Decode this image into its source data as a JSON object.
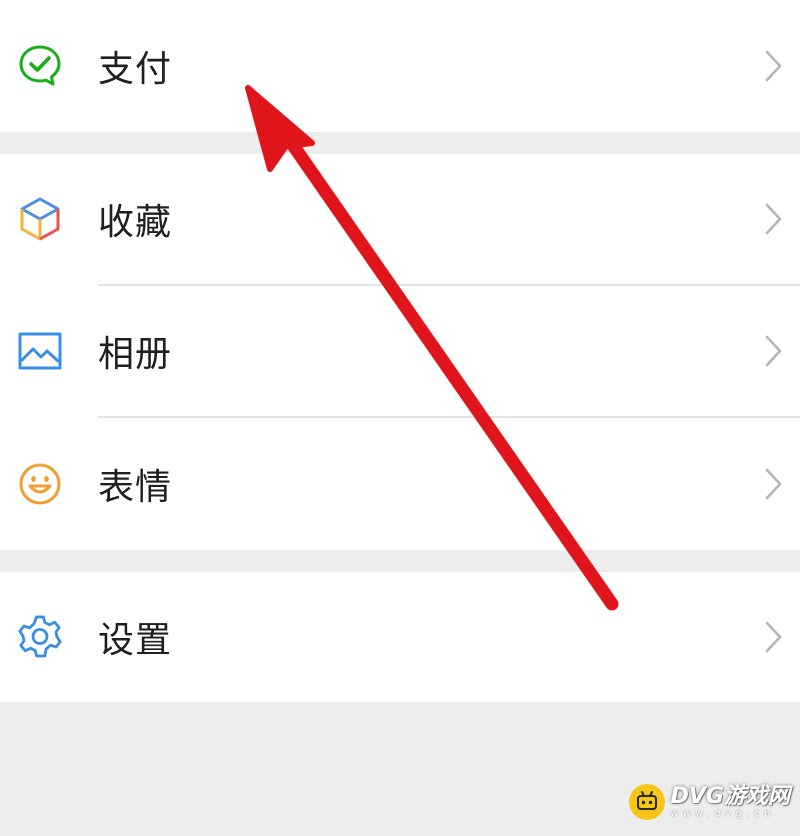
{
  "menu": {
    "items": [
      {
        "label": "支付",
        "icon": "wallet-check-icon",
        "color": "#1aad19"
      },
      {
        "label": "收藏",
        "icon": "cube-icon",
        "color": "#4a90e2"
      },
      {
        "label": "相册",
        "icon": "photo-album-icon",
        "color": "#3a8ee6"
      },
      {
        "label": "表情",
        "icon": "smiley-icon",
        "color": "#f0a030"
      },
      {
        "label": "设置",
        "icon": "gear-icon",
        "color": "#3a8ee6"
      }
    ]
  },
  "annotation": {
    "arrow_color": "#e0151b",
    "arrow_target": "支付"
  },
  "watermark": {
    "main": "DVG游戏网",
    "sub": "www.dvg.cn"
  }
}
